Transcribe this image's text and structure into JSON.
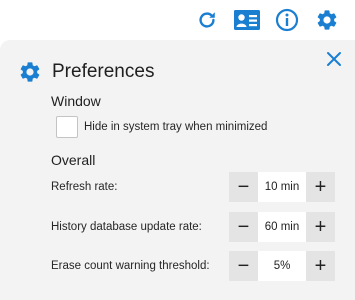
{
  "toolbar": {
    "icons": [
      "refresh-icon",
      "contact-card-icon",
      "info-icon",
      "gear-icon"
    ],
    "accent_color": "#1a7fd1"
  },
  "panel": {
    "title": "Preferences",
    "background": "#f3f3f3",
    "window_section": {
      "title": "Window",
      "hide_in_tray_label": "Hide in system tray when minimized",
      "hide_in_tray_checked": false
    },
    "overall_section": {
      "title": "Overall",
      "settings": [
        {
          "label": "Refresh rate:",
          "value": "10 min",
          "minus": "−",
          "plus": "+"
        },
        {
          "label": "History database update rate:",
          "value": "60 min",
          "minus": "−",
          "plus": "+"
        },
        {
          "label": "Erase count warning threshold:",
          "value": "5%",
          "minus": "−",
          "plus": "+"
        }
      ]
    }
  }
}
